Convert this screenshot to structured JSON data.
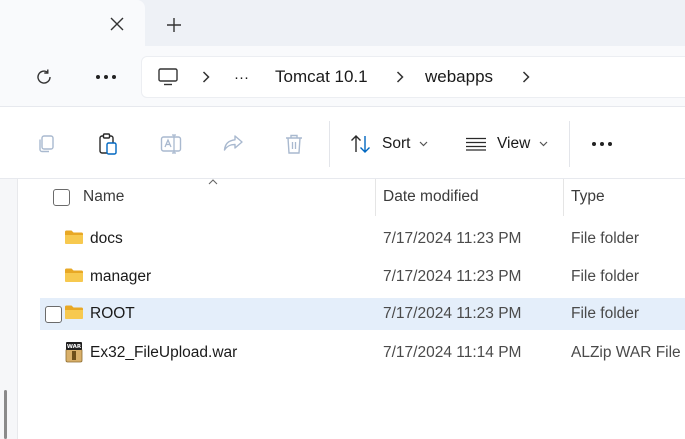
{
  "tabstrip": {
    "close_icon": "close-icon",
    "new_tab_icon": "plus-icon"
  },
  "addressbar": {
    "refresh_icon": "refresh-icon",
    "more_icon": "more-horizontal-icon",
    "computer_icon": "computer-icon",
    "overflow_label": "···",
    "breadcrumb": [
      "Tomcat 10.1",
      "webapps"
    ]
  },
  "toolbar": {
    "sort_label": "Sort",
    "view_label": "View",
    "more_label": "···"
  },
  "columns": {
    "name": "Name",
    "date_modified": "Date modified",
    "type": "Type"
  },
  "files": [
    {
      "name": "docs",
      "date": "7/17/2024 11:23 PM",
      "type": "File folder",
      "icon": "folder-icon",
      "selected": false
    },
    {
      "name": "manager",
      "date": "7/17/2024 11:23 PM",
      "type": "File folder",
      "icon": "folder-icon",
      "selected": false
    },
    {
      "name": "ROOT",
      "date": "7/17/2024 11:23 PM",
      "type": "File folder",
      "icon": "folder-icon",
      "selected": true
    },
    {
      "name": "Ex32_FileUpload.war",
      "date": "7/17/2024 11:14 PM",
      "type": "ALZip WAR File",
      "icon": "war-file-icon",
      "selected": false
    }
  ],
  "colors": {
    "accent": "#0067c0",
    "folder": "#f3c14a",
    "selection": "#e4eefa"
  }
}
